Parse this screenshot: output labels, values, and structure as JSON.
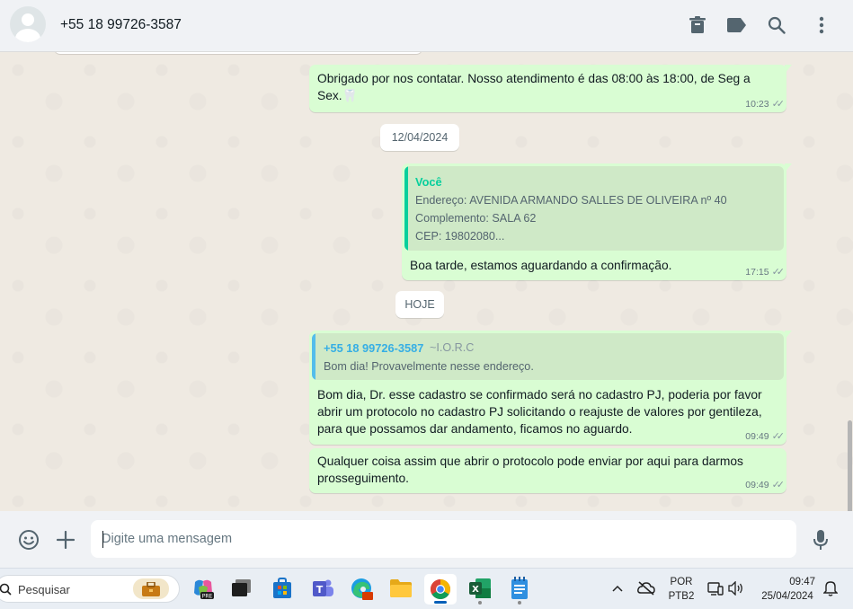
{
  "header": {
    "contact_name": "+55 18 99726-3587",
    "icons": [
      "archive-icon",
      "label-icon",
      "search-icon",
      "menu-icon"
    ]
  },
  "messages": [
    {
      "text_line1": "Obrigado por nos contatar. Nosso atendimento é das 08:00 às 18:00, de Seg a",
      "text_line2": "Sex.🦷",
      "time": "10:23"
    },
    {
      "date": "12/04/2024",
      "quote_author": "Você",
      "quote_line1": "Endereço: AVENIDA ARMANDO SALLES DE OLIVEIRA nº 40",
      "quote_line2": "Complemento: SALA 62",
      "quote_line3": "CEP: 19802080...",
      "text": "Boa tarde, estamos aguardando a confirmação.",
      "time": "17:15"
    },
    {
      "date": "HOJE",
      "quote_author": "+55 18 99726-3587",
      "quote_sender_tag": "~I.O.R.C",
      "quote_text": "Bom dia! Provavelmente nesse endereço.",
      "text_line1": "Bom dia, Dr. esse cadastro se confirmado será no cadastro PJ, poderia por favor",
      "text_line2": "abrir um protocolo no cadastro PJ solicitando o reajuste de valores por gentileza,",
      "text_line3": "para que possamos dar andamento, ficamos no aguardo.",
      "time": "09:49"
    },
    {
      "text_line1": "Qualquer coisa assim que abrir o protocolo pode enviar por aqui para darmos",
      "text_line2": "prosseguimento.",
      "time": "09:49"
    }
  ],
  "composer": {
    "placeholder": "Digite uma mensagem"
  },
  "taskbar": {
    "search_label": "Pesquisar",
    "lang_line1": "POR",
    "lang_line2": "PTB2",
    "clock_time": "09:47",
    "clock_date": "25/04/2024"
  },
  "colors": {
    "outgoing_bubble": "#d9fdd3",
    "quote_you": "#06cf9c",
    "quote_contact": "#53bdeb",
    "quote_author_contact": "#35aee5",
    "quote_author_you": "#06cf9c"
  }
}
